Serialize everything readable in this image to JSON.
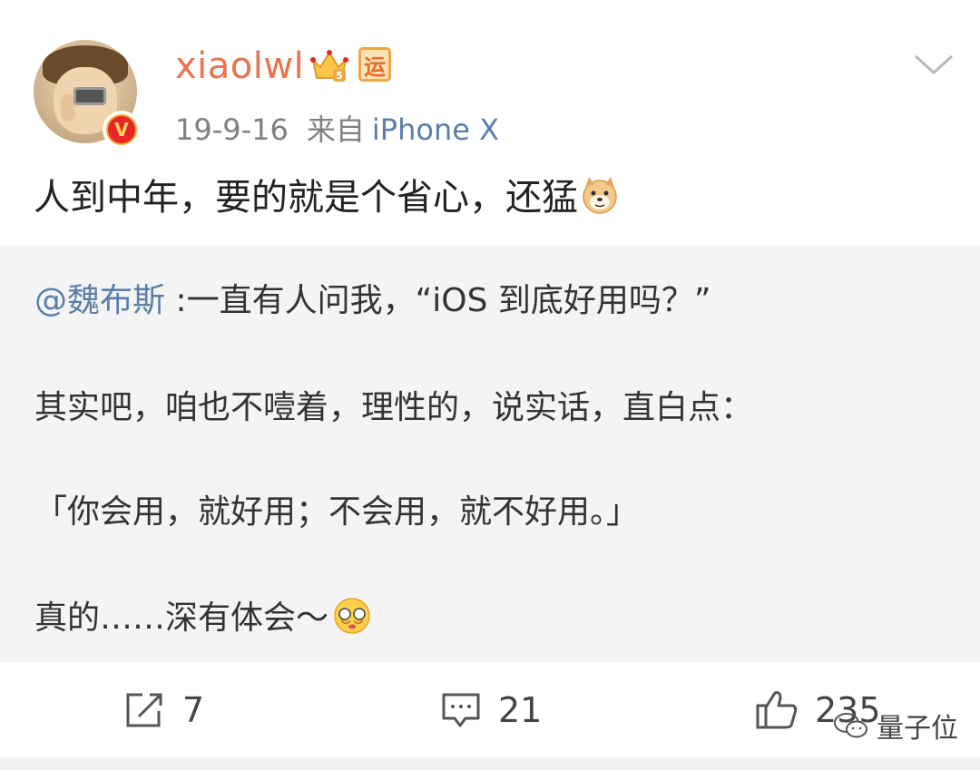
{
  "post": {
    "username": "xiaolwl",
    "badge_yun": "运",
    "verify_mark": "V",
    "date": "19-9-16",
    "source_prefix": "来自",
    "source_device": "iPhone X",
    "text": "人到中年，要的就是个省心，还猛"
  },
  "repost": {
    "mention": "@魏布斯",
    "line1_rest": " :一直有人问我，“iOS 到底好用吗？”",
    "line2": "其实吧，咱也不噎着，理性的，说实话，直白点：",
    "line3": "「你会用，就好用；不会用，就不好用。」",
    "line4": "真的……深有体会～"
  },
  "actions": {
    "repost_count": "7",
    "comment_count": "21",
    "like_count": "235"
  },
  "watermark": {
    "text": "量子位"
  },
  "icons": {
    "crown": "vip-crown-icon",
    "doge": "doge-emoji-icon",
    "shy": "shy-emoji-icon",
    "repost": "repost-icon",
    "comment": "comment-icon",
    "like": "thumbs-up-icon",
    "chevron": "chevron-down-icon"
  },
  "colors": {
    "username": "#eb7350",
    "link": "#5b7fa8",
    "meta": "#808080",
    "repost_bg": "#f4f4f4"
  }
}
